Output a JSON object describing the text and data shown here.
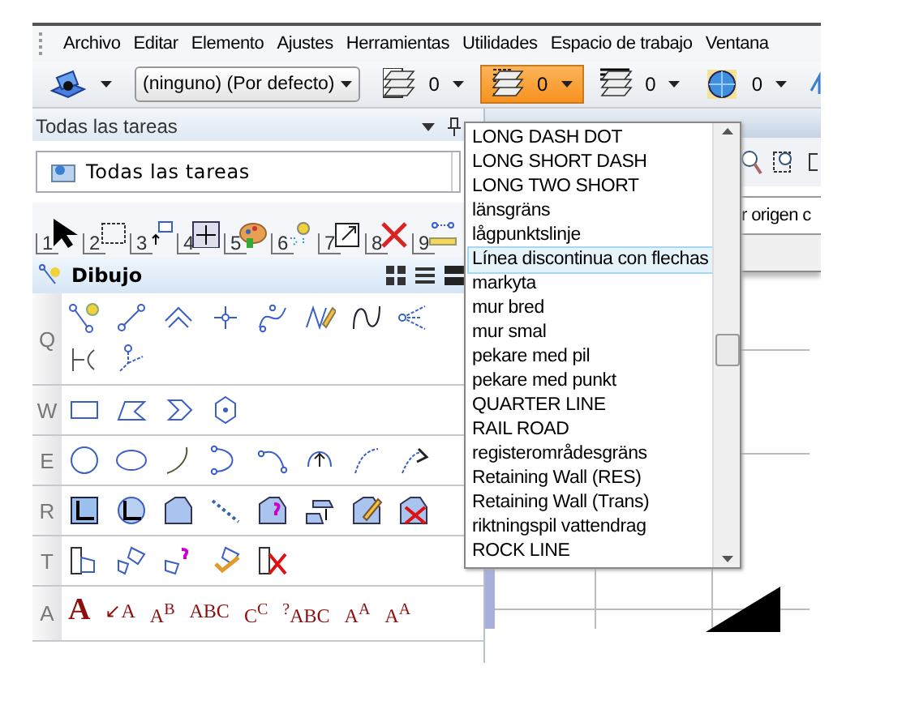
{
  "menu": [
    "Archivo",
    "Editar",
    "Elemento",
    "Ajustes",
    "Herramientas",
    "Utilidades",
    "Espacio de trabajo",
    "Ventana"
  ],
  "toolbar": {
    "level_combo": "(ninguno) (Por defecto)",
    "groups": [
      {
        "value": "0",
        "selected": false
      },
      {
        "value": "0",
        "selected": true
      },
      {
        "value": "0",
        "selected": false
      },
      {
        "value": "0",
        "selected": false
      }
    ]
  },
  "task_panel": {
    "title": "Todas las tareas",
    "task_combo": "Todas las tareas",
    "tool_numbers": [
      "1",
      "2",
      "3",
      "4",
      "5",
      "6",
      "7",
      "8",
      "9"
    ],
    "section_title": "Dibujo",
    "sections": [
      {
        "label": "Q"
      },
      {
        "label": "W"
      },
      {
        "label": "E"
      },
      {
        "label": "R"
      },
      {
        "label": "T"
      },
      {
        "label": "A",
        "tool_texts": [
          "A",
          "↙A",
          "A$^{B}$",
          "ABC",
          "C$^{C}$",
          "$^{?}$ABC",
          "A$^{A}$",
          "A$^{A}$"
        ]
      }
    ]
  },
  "line_styles": {
    "items": [
      {
        "label": "LONG DASH DOT",
        "selected": false
      },
      {
        "label": "LONG SHORT DASH",
        "selected": false
      },
      {
        "label": "LONG TWO SHORT",
        "selected": false
      },
      {
        "label": "länsgräns",
        "selected": false
      },
      {
        "label": "lågpunktslinje",
        "selected": false
      },
      {
        "label": "Línea discontinua con flechas",
        "selected": true
      },
      {
        "label": "markyta",
        "selected": false
      },
      {
        "label": "mur bred",
        "selected": false
      },
      {
        "label": "mur smal",
        "selected": false
      },
      {
        "label": "pekare med pil",
        "selected": false
      },
      {
        "label": "pekare med punkt",
        "selected": false
      },
      {
        "label": "QUARTER LINE",
        "selected": false
      },
      {
        "label": "RAIL ROAD",
        "selected": false
      },
      {
        "label": "registerområdesgräns",
        "selected": false
      },
      {
        "label": "Retaining Wall (RES)",
        "selected": false
      },
      {
        "label": "Retaining Wall (Trans)",
        "selected": false
      },
      {
        "label": "riktningspil vattendrag",
        "selected": false
      },
      {
        "label": "ROCK LINE",
        "selected": false
      }
    ]
  },
  "main_view": {
    "field_text": "r origen c"
  }
}
